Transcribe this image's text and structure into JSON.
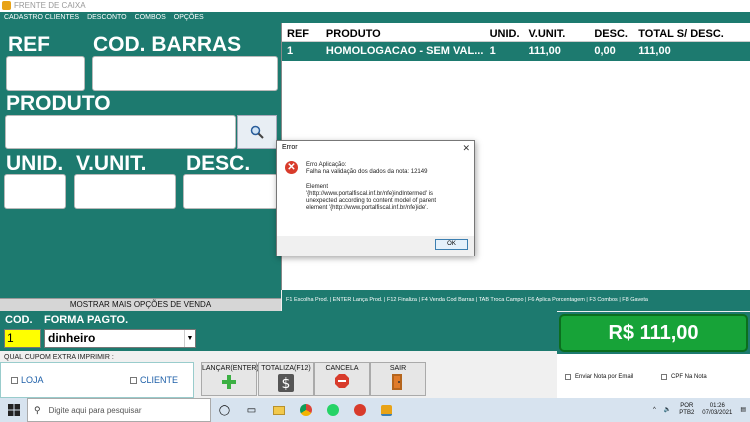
{
  "window": {
    "title": "FRENTE DE CAIXA"
  },
  "menu": [
    "CADASTRO CLIENTES",
    "DESCONTO",
    "COMBOS",
    "OPÇÕES"
  ],
  "left": {
    "ref_label": "REF",
    "barcode_label": "COD. BARRAS",
    "produto_label": "PRODUTO",
    "unid_label": "UNID.",
    "vunit_label": "V.UNIT.",
    "desc_label": "DESC.",
    "more_options": "MOSTRAR MAIS OPÇÕES DE VENDA"
  },
  "grid": {
    "columns": [
      "REF",
      "PRODUTO",
      "UNID.",
      "V.UNIT.",
      "DESC.",
      "TOTAL S/ DESC."
    ],
    "rows": [
      [
        "1",
        "HOMOLOGACAO - SEM VAL...",
        "1",
        "111,00",
        "0,00",
        "111,00"
      ]
    ]
  },
  "shortcuts": "F1 Escolha Prod.  |  ENTER Lança Prod.  |  F12 Finaliza  |  F4 Venda Cod Barras  |  TAB Troca Campo  |  F6 Aplica Porcentagem  |  F3 Combos  |  F8 Gaveta",
  "payment": {
    "cod_label": "COD.",
    "cod_value": "1",
    "forma_label": "FORMA PAGTO.",
    "forma_value": "dinheiro"
  },
  "total": "R$ 111,00",
  "cupom": {
    "label": "QUAL CUPOM EXTRA  IMPRIMIR :",
    "loja": "LOJA",
    "cliente": "CLIENTE"
  },
  "actions": {
    "lancar": "LANÇAR(ENTER)",
    "totaliza": "TOTALIZA(F12)",
    "cancela": "CANCELA",
    "sair": "SAIR"
  },
  "options": {
    "enviar_email": "Enviar Nota por Email",
    "cpf": "CPF Na Nota"
  },
  "dialog": {
    "title": "Error",
    "message": "Erro Aplicação:\nFalha na validação dos dados da nota: 12149\n\nElement\n'{http://www.portalfiscal.inf.br/nfe}indIntermed' is\nunexpected according to content model of parent\nelement '{http://www.portalfiscal.inf.br/nfe}ide'.",
    "ok": "OK"
  },
  "taskbar": {
    "search_placeholder": "Digite aqui para pesquisar",
    "lang": "POR",
    "layout": "PTB2",
    "time": "01:26",
    "date": "07/03/2021"
  },
  "colors": {
    "teal": "#1d7a6f",
    "total_green": "#17a338",
    "cod_yellow": "#ffff00"
  }
}
